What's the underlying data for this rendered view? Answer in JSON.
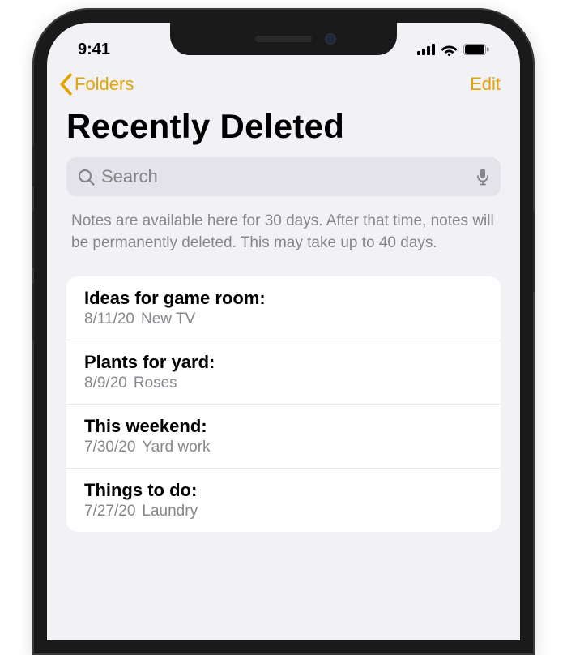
{
  "status": {
    "time": "9:41"
  },
  "nav": {
    "back_label": "Folders",
    "edit_label": "Edit"
  },
  "page": {
    "title": "Recently Deleted",
    "info": "Notes are available here for 30 days. After that time, notes will be permanently deleted. This may take up to 40 days."
  },
  "search": {
    "placeholder": "Search"
  },
  "notes": [
    {
      "title": "Ideas for game room:",
      "date": "8/11/20",
      "preview": "New TV"
    },
    {
      "title": "Plants for yard:",
      "date": "8/9/20",
      "preview": "Roses"
    },
    {
      "title": "This weekend:",
      "date": "7/30/20",
      "preview": "Yard work"
    },
    {
      "title": "Things to do:",
      "date": "7/27/20",
      "preview": "Laundry"
    }
  ]
}
